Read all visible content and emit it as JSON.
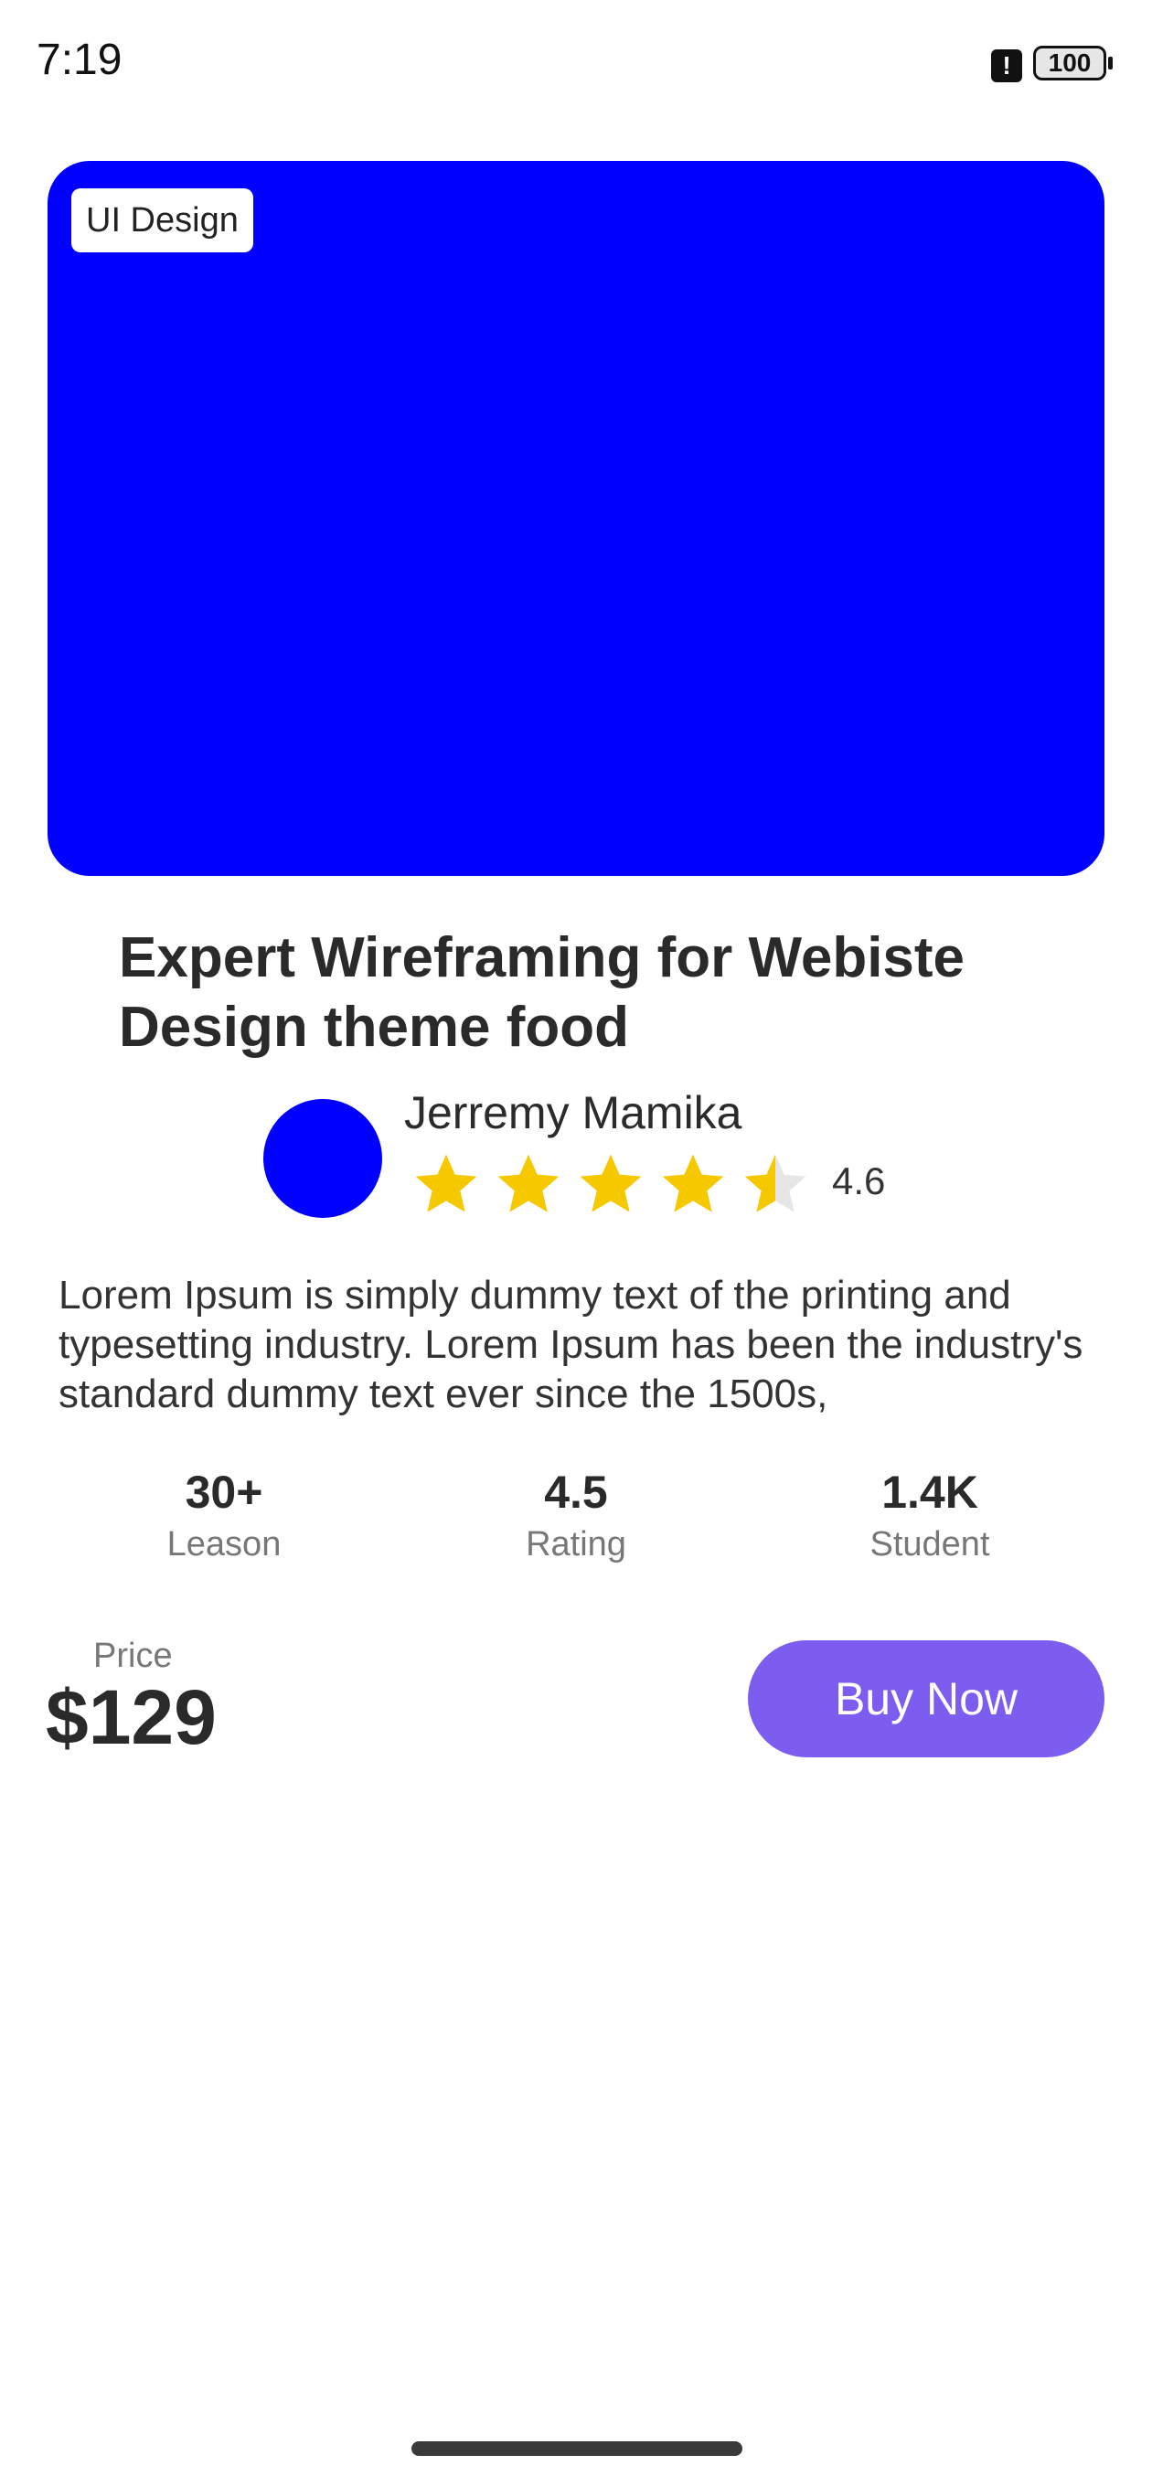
{
  "status_bar": {
    "time": "7:19",
    "battery": "100",
    "alert_icon": "alert-icon"
  },
  "hero": {
    "tag": "UI Design",
    "color": "#0000ff"
  },
  "course": {
    "title": "Expert Wireframing for Webiste Design theme food"
  },
  "author": {
    "name": "Jerremy Mamika",
    "rating_display": "4.6",
    "rating_value": 4.6,
    "rating_max": 5,
    "avatar_color": "#0000ff"
  },
  "description": "Lorem Ipsum is simply dummy text of the printing and typesetting industry. Lorem Ipsum has been the industry's standard dummy text ever since the 1500s,",
  "stats": [
    {
      "value": "30+",
      "label": "Leason"
    },
    {
      "value": "4.5",
      "label": "Rating"
    },
    {
      "value": "1.4K",
      "label": "Student"
    }
  ],
  "purchase": {
    "price_label": "Price",
    "price": "$129",
    "buy_label": "Buy Now",
    "button_color": "#7d5cf0"
  },
  "colors": {
    "star": "#f5c800",
    "star_empty": "#e6e6e6"
  }
}
